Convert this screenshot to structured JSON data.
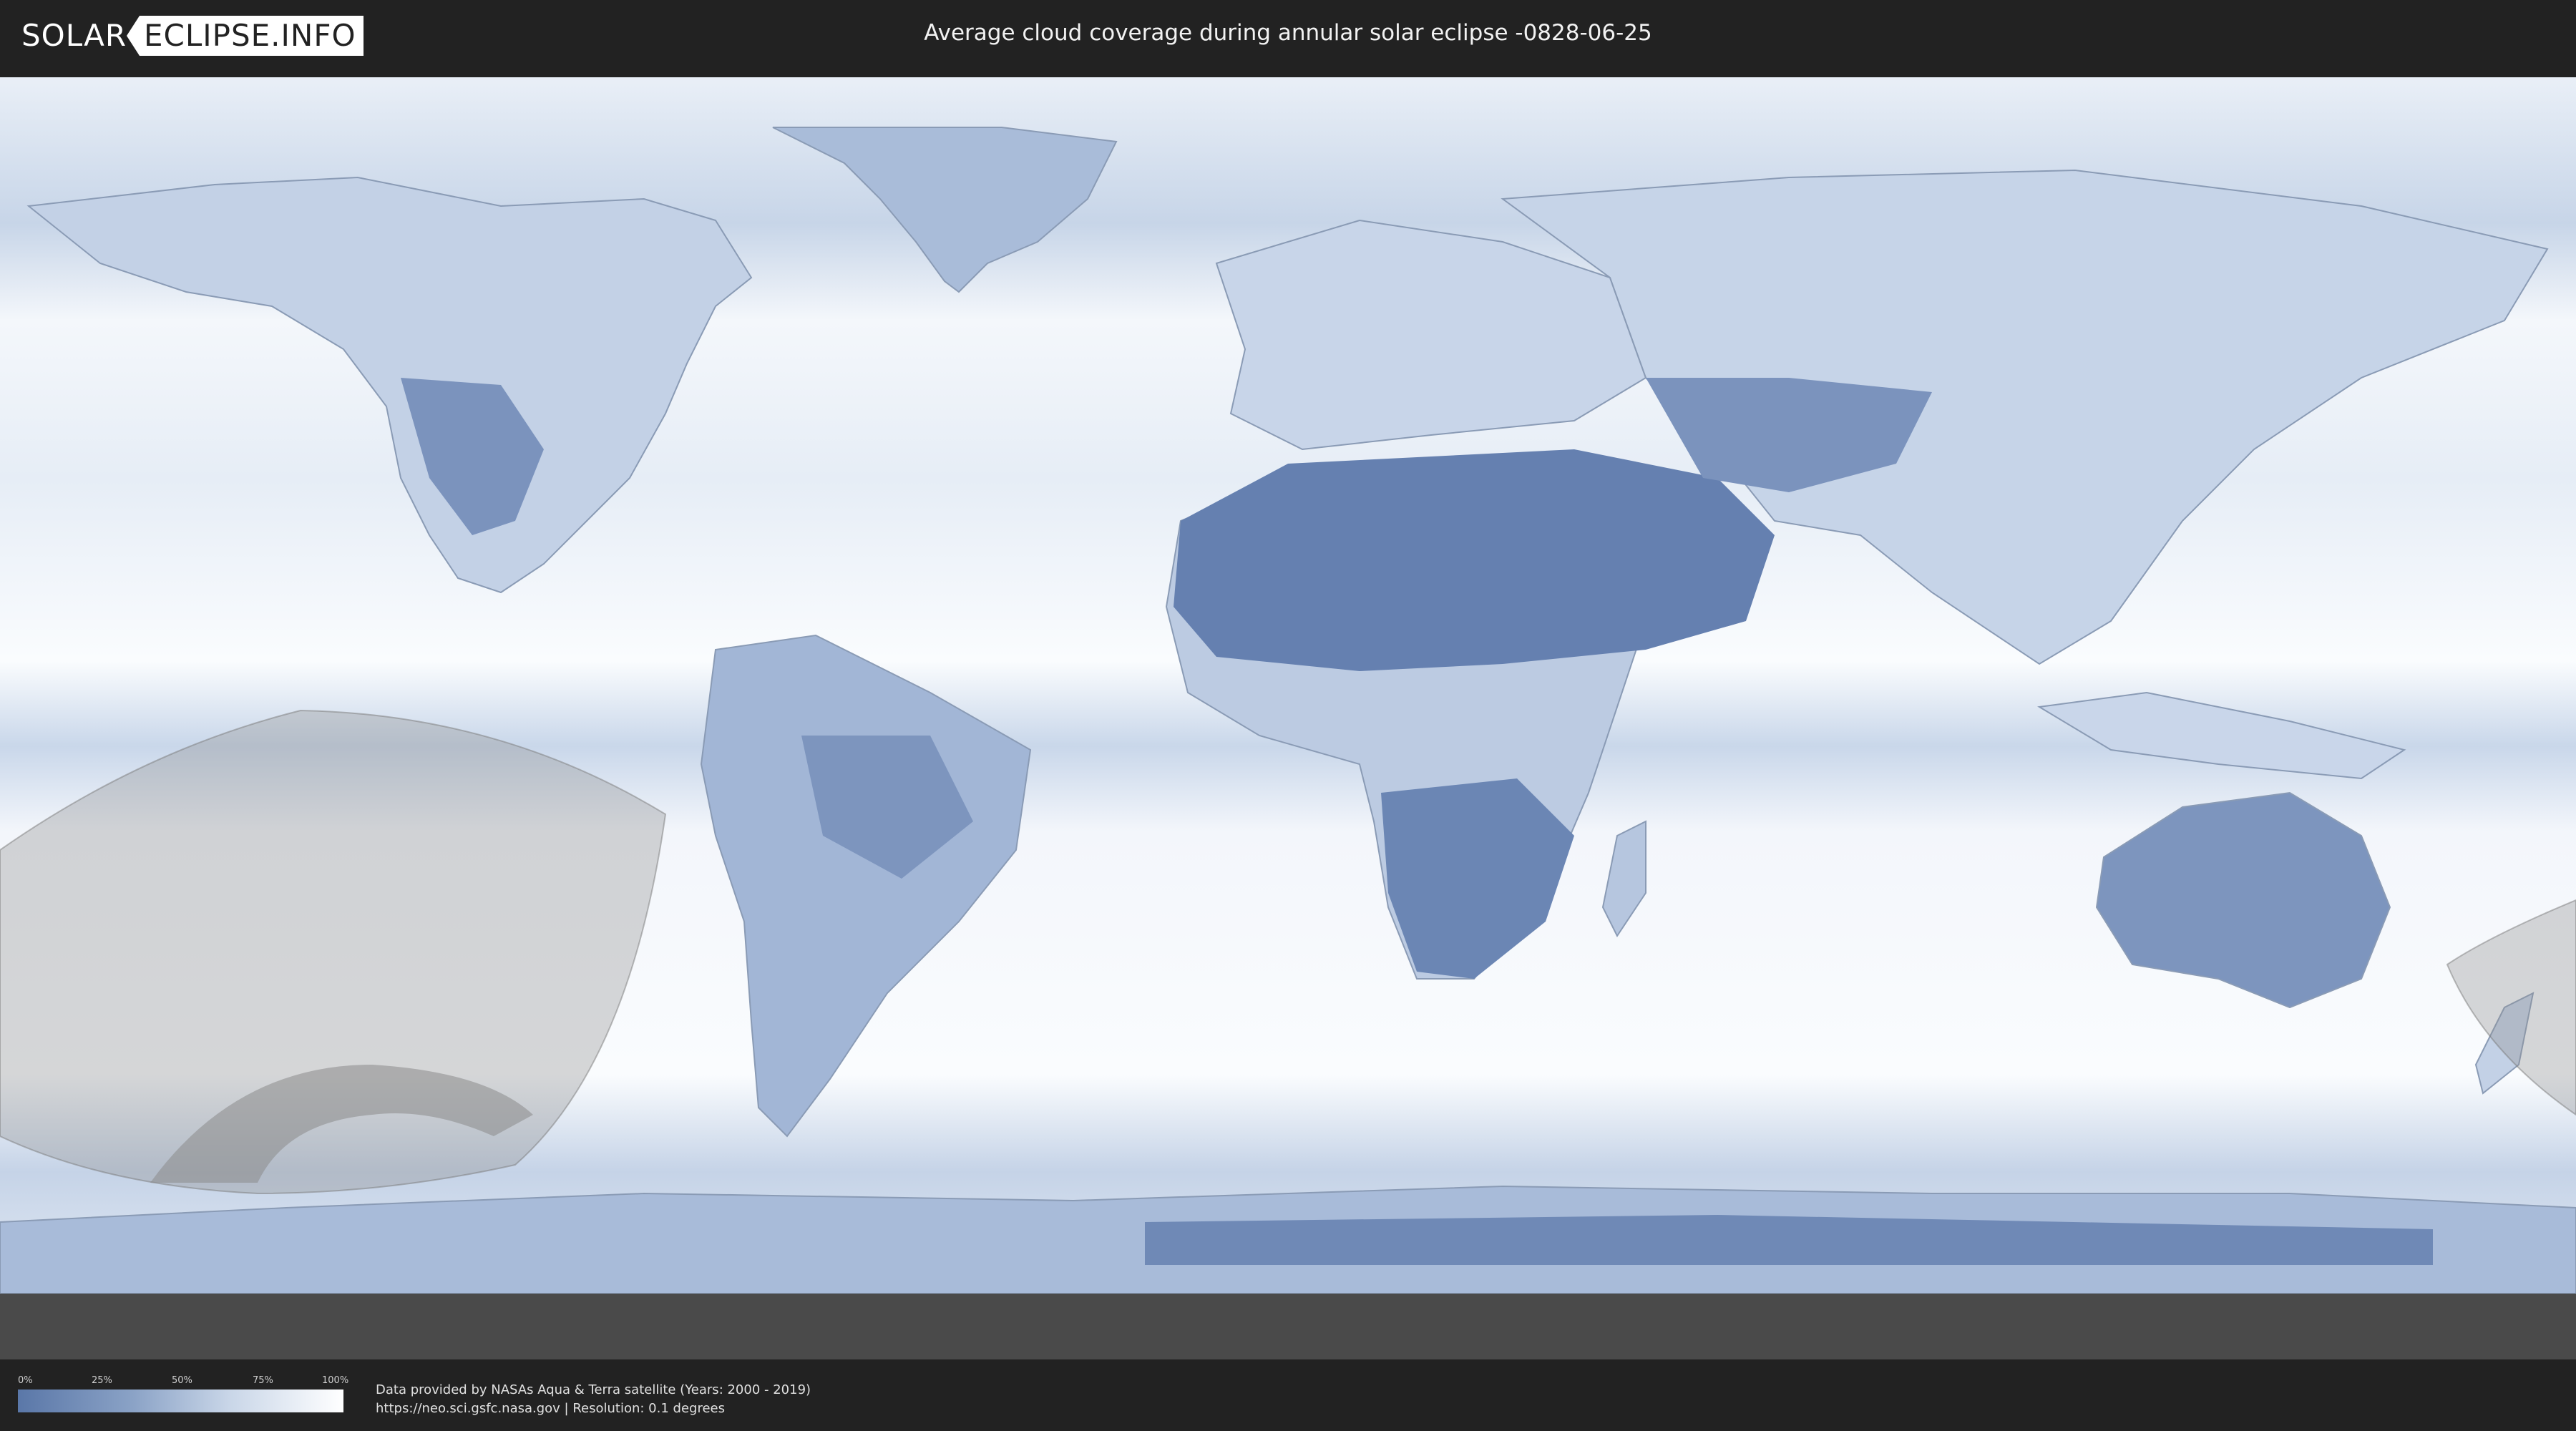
{
  "header": {
    "logo_left": "SOLAR",
    "logo_right": "ECLIPSE.INFO",
    "title": "Average cloud coverage during annular solar eclipse -0828-06-25"
  },
  "map": {
    "land_color": "#5f7bab",
    "ocean_color": "#f2f6fb",
    "eclipse_shadow_color": "#9a9a9a"
  },
  "legend": {
    "ticks": [
      "0%",
      "25%",
      "50%",
      "75%",
      "100%"
    ],
    "colors": [
      "#5a77a8",
      "#ffffff"
    ]
  },
  "credits": {
    "line1": "Data provided by NASAs Aqua & Terra satellite (Years: 2000 - 2019)",
    "line2": "https://neo.sci.gsfc.nasa.gov | Resolution: 0.1 degrees"
  }
}
